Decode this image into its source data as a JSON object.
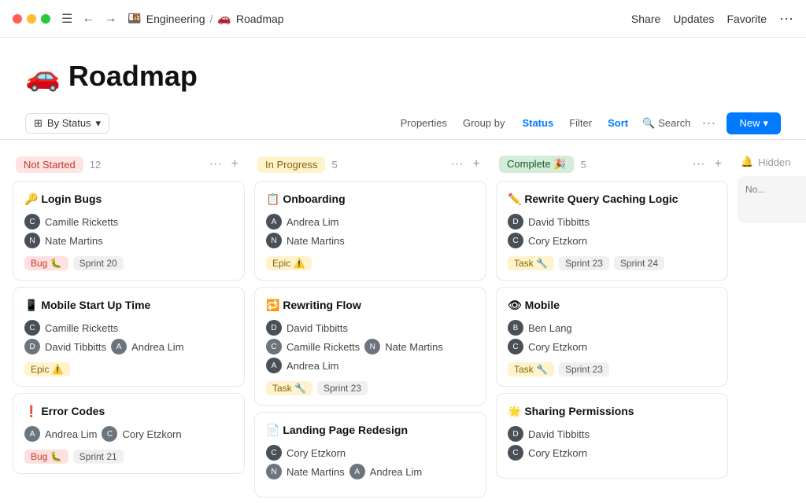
{
  "titlebar": {
    "breadcrumb_parent": "Engineering",
    "breadcrumb_current": "Roadmap",
    "breadcrumb_emoji": "🚗",
    "breadcrumb_parent_emoji": "🍱",
    "actions": [
      "Share",
      "Updates",
      "Favorite",
      "···"
    ]
  },
  "page": {
    "title": "Roadmap",
    "emoji": "🚗"
  },
  "toolbar": {
    "view_icon": "⊞",
    "view_label": "By Status",
    "properties_label": "Properties",
    "group_by_label": "Group by",
    "group_by_value": "Status",
    "filter_label": "Filter",
    "sort_label": "Sort",
    "search_label": "Search",
    "more_label": "···",
    "new_label": "New",
    "chevron": "▾"
  },
  "columns": [
    {
      "id": "not-started",
      "status_label": "Not Started",
      "status_class": "status-not-started",
      "count": 12,
      "cards": [
        {
          "title": "🔑 Login Bugs",
          "members": [
            {
              "name": "Camille Ricketts"
            },
            {
              "name": "Nate Martins"
            }
          ],
          "tags": [
            {
              "label": "Bug 🐛",
              "cls": "tag-bug"
            },
            {
              "label": "Sprint 20",
              "cls": "tag-sprint"
            }
          ]
        },
        {
          "title": "📱 Mobile Start Up Time",
          "members": [
            {
              "name": "Camille Ricketts"
            },
            {
              "name": "David Tibbitts  Andrea Lim",
              "multi": true
            }
          ],
          "tags": [
            {
              "label": "Epic ⚠️",
              "cls": "tag-epic"
            }
          ]
        },
        {
          "title": "❗ Error Codes",
          "members": [
            {
              "name": "Andrea Lim  Cory Etzkorn",
              "multi": true
            }
          ],
          "tags": [
            {
              "label": "Bug 🐛",
              "cls": "tag-bug"
            },
            {
              "label": "Sprint 21",
              "cls": "tag-sprint"
            }
          ]
        }
      ]
    },
    {
      "id": "in-progress",
      "status_label": "In Progress",
      "status_class": "status-in-progress",
      "count": 5,
      "cards": [
        {
          "title": "📋 Onboarding",
          "members": [
            {
              "name": "Andrea Lim"
            },
            {
              "name": "Nate Martins"
            }
          ],
          "tags": [
            {
              "label": "Epic ⚠️",
              "cls": "tag-epic"
            }
          ]
        },
        {
          "title": "🔁 Rewriting Flow",
          "members": [
            {
              "name": "David Tibbitts"
            },
            {
              "name": "Camille Ricketts  Nate Martins",
              "multi": true
            },
            {
              "name": "Andrea Lim"
            }
          ],
          "tags": [
            {
              "label": "Task 🔧",
              "cls": "tag-task"
            },
            {
              "label": "Sprint 23",
              "cls": "tag-sprint"
            }
          ]
        },
        {
          "title": "📄 Landing Page Redesign",
          "members": [
            {
              "name": "Cory Etzkorn"
            },
            {
              "name": "Nate Martins  Andrea Lim",
              "multi": true
            }
          ],
          "tags": []
        }
      ]
    },
    {
      "id": "complete",
      "status_label": "Complete 🎉",
      "status_class": "status-complete",
      "count": 5,
      "cards": [
        {
          "title": "✏️ Rewrite Query Caching Logic",
          "members": [
            {
              "name": "David Tibbitts"
            },
            {
              "name": "Cory Etzkorn"
            }
          ],
          "tags": [
            {
              "label": "Task 🔧",
              "cls": "tag-task"
            },
            {
              "label": "Sprint 23",
              "cls": "tag-sprint"
            },
            {
              "label": "Sprint 24",
              "cls": "tag-sprint"
            }
          ]
        },
        {
          "title": "👁 Mobile",
          "members": [
            {
              "name": "Ben Lang"
            },
            {
              "name": "Cory Etzkorn"
            }
          ],
          "tags": [
            {
              "label": "Task 🔧",
              "cls": "tag-task"
            },
            {
              "label": "Sprint 23",
              "cls": "tag-sprint"
            }
          ]
        },
        {
          "title": "🌟 Sharing Permissions",
          "members": [
            {
              "name": "David Tibbitts"
            },
            {
              "name": "Cory Etzkorn"
            }
          ],
          "tags": []
        }
      ]
    }
  ],
  "hidden_column": {
    "label": "Hidden",
    "item": "No..."
  }
}
